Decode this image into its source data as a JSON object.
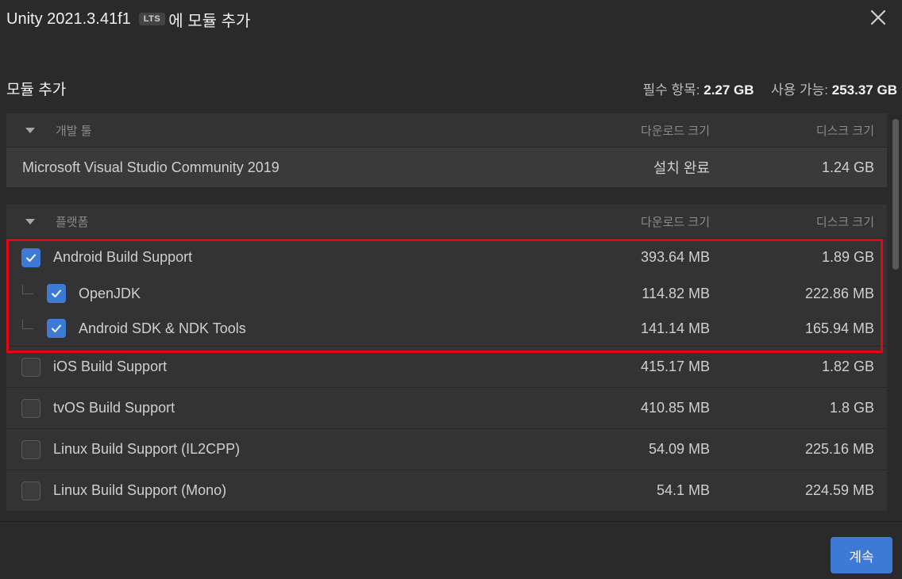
{
  "window": {
    "title_prefix": "Unity 2021.3.41f1",
    "badge": "LTS",
    "title_suffix": "에 모듈 추가",
    "close_icon": "close-icon"
  },
  "header": {
    "title": "모듈 추가",
    "required_label": "필수 항목:",
    "required_value": "2.27 GB",
    "available_label": "사용 가능:",
    "available_value": "253.37 GB"
  },
  "groups": [
    {
      "name": "개발 툴",
      "col_download": "다운로드 크기",
      "col_disk": "디스크 크기",
      "rows": [
        {
          "name": "Microsoft Visual Studio Community 2019",
          "download": "설치 완료",
          "disk": "1.24 GB"
        }
      ]
    },
    {
      "name": "플랫폼",
      "col_download": "다운로드 크기",
      "col_disk": "디스크 크기",
      "rows": [
        {
          "name": "Android Build Support",
          "download": "393.64 MB",
          "disk": "1.89 GB",
          "checked": true
        },
        {
          "name": "OpenJDK",
          "download": "114.82 MB",
          "disk": "222.86 MB",
          "checked": true,
          "child": true
        },
        {
          "name": "Android SDK & NDK Tools",
          "download": "141.14 MB",
          "disk": "165.94 MB",
          "checked": true,
          "child": true
        },
        {
          "name": "iOS Build Support",
          "download": "415.17 MB",
          "disk": "1.82 GB",
          "checked": false
        },
        {
          "name": "tvOS Build Support",
          "download": "410.85 MB",
          "disk": "1.8 GB",
          "checked": false
        },
        {
          "name": "Linux Build Support (IL2CPP)",
          "download": "54.09 MB",
          "disk": "225.16 MB",
          "checked": false
        },
        {
          "name": "Linux Build Support (Mono)",
          "download": "54.1 MB",
          "disk": "224.59 MB",
          "checked": false
        }
      ]
    }
  ],
  "footer": {
    "continue_label": "계속"
  },
  "colors": {
    "accent": "#3d7ad6",
    "highlight": "#e30613",
    "background": "#2a2a2a"
  }
}
